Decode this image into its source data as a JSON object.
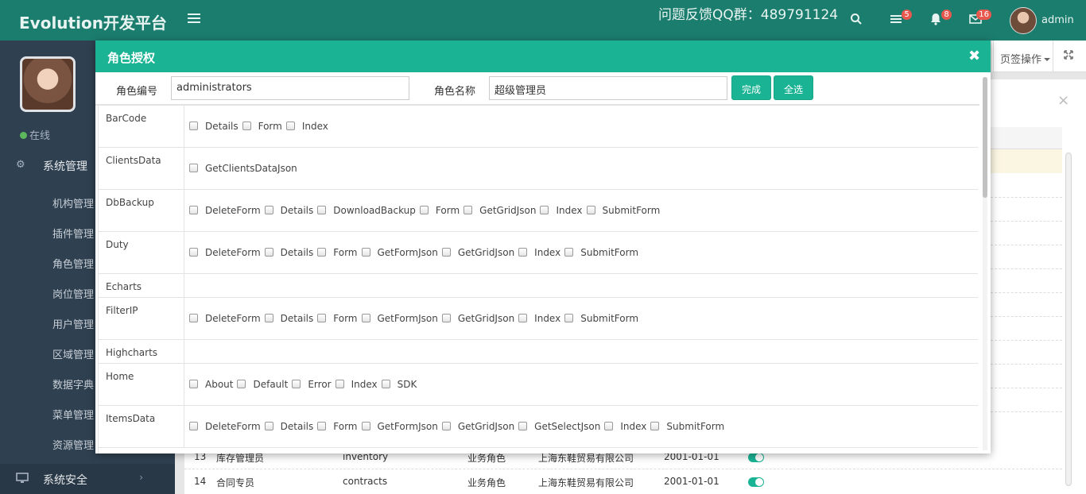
{
  "header": {
    "brand": "Evolution开发平台",
    "qq_notice": "问题反馈QQ群：489791124",
    "badges": {
      "tasks": "5",
      "notifications": "8",
      "messages": "16"
    },
    "user_name": "admin"
  },
  "sidebar": {
    "status": "在线",
    "group1": "系统管理",
    "items": [
      "机构管理",
      "插件管理",
      "角色管理",
      "岗位管理",
      "用户管理",
      "区域管理",
      "数据字典",
      "菜单管理",
      "资源管理"
    ],
    "group2": "系统安全"
  },
  "toolbar": {
    "page_ops": "页签操作"
  },
  "background_rows": [
    {
      "no": "13",
      "name": "库存管理员",
      "code": "inventory",
      "type": "业务角色",
      "org": "上海东鞋贸易有限公司",
      "date": "2001-01-01"
    },
    {
      "no": "14",
      "name": "合同专员",
      "code": "contracts",
      "type": "业务角色",
      "org": "上海东鞋贸易有限公司",
      "date": "2001-01-01"
    }
  ],
  "modal": {
    "title": "角色授权",
    "role_code_label": "角色编号",
    "role_code_value": "administrators",
    "role_name_label": "角色名称",
    "role_name_value": "超级管理员",
    "done_button": "完成",
    "select_all_button": "全选",
    "controllers": [
      {
        "name": "BarCode",
        "actions": [
          "Details",
          "Form",
          "Index"
        ]
      },
      {
        "name": "ClientsData",
        "actions": [
          "GetClientsDataJson"
        ]
      },
      {
        "name": "DbBackup",
        "actions": [
          "DeleteForm",
          "Details",
          "DownloadBackup",
          "Form",
          "GetGridJson",
          "Index",
          "SubmitForm"
        ]
      },
      {
        "name": "Duty",
        "actions": [
          "DeleteForm",
          "Details",
          "Form",
          "GetFormJson",
          "GetGridJson",
          "Index",
          "SubmitForm"
        ]
      },
      {
        "name": "Echarts",
        "actions": []
      },
      {
        "name": "FilterIP",
        "actions": [
          "DeleteForm",
          "Details",
          "Form",
          "GetFormJson",
          "GetGridJson",
          "Index",
          "SubmitForm"
        ]
      },
      {
        "name": "Highcharts",
        "actions": []
      },
      {
        "name": "Home",
        "actions": [
          "About",
          "Default",
          "Error",
          "Index",
          "SDK"
        ]
      },
      {
        "name": "ItemsData",
        "actions": [
          "DeleteForm",
          "Details",
          "Form",
          "GetFormJson",
          "GetGridJson",
          "GetSelectJson",
          "Index",
          "SubmitForm"
        ]
      }
    ]
  }
}
